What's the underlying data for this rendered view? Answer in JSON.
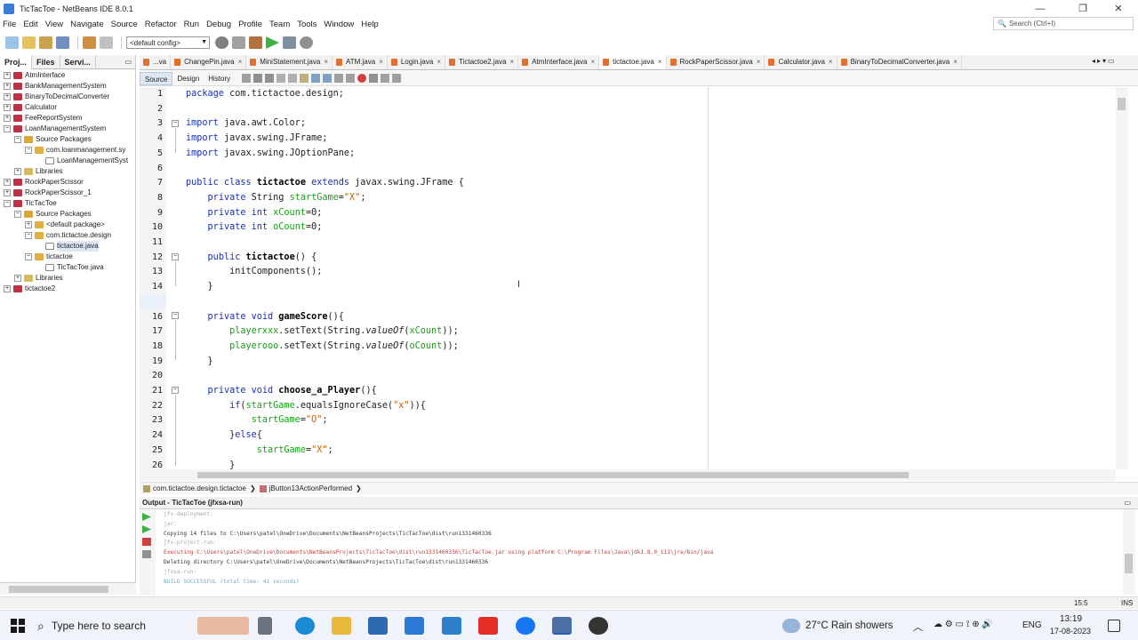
{
  "window": {
    "title": "TicTacToe - NetBeans IDE 8.0.1",
    "controls": [
      "—",
      "❐",
      "✕"
    ]
  },
  "menu": [
    "File",
    "Edit",
    "View",
    "Navigate",
    "Source",
    "Refactor",
    "Run",
    "Debug",
    "Profile",
    "Team",
    "Tools",
    "Window",
    "Help"
  ],
  "search": {
    "placeholder": "Search (Ctrl+I)"
  },
  "toolbar": {
    "config": "<default config>"
  },
  "left_panel": {
    "tabs": [
      "Proj...",
      "Files",
      "Servi..."
    ],
    "tree": [
      {
        "label": "AtmInterface",
        "type": "proj",
        "indent": 0,
        "exp": "+"
      },
      {
        "label": "BankManagementSystem",
        "type": "proj",
        "indent": 0,
        "exp": "+"
      },
      {
        "label": "BinaryToDecimalConverter",
        "type": "proj",
        "indent": 0,
        "exp": "+"
      },
      {
        "label": "Calculator",
        "type": "proj",
        "indent": 0,
        "exp": "+"
      },
      {
        "label": "FeeReportSystem",
        "type": "proj",
        "indent": 0,
        "exp": "+"
      },
      {
        "label": "LoanManagementSystem",
        "type": "proj",
        "indent": 0,
        "exp": "−"
      },
      {
        "label": "Source Packages",
        "type": "src",
        "indent": 1,
        "exp": "−"
      },
      {
        "label": "com.loanmanagement.sy",
        "type": "pkg",
        "indent": 2,
        "exp": "−"
      },
      {
        "label": "LoanManagementSyst",
        "type": "java",
        "indent": 3,
        "exp": ""
      },
      {
        "label": "Libraries",
        "type": "lib",
        "indent": 1,
        "exp": "+"
      },
      {
        "label": "RockPaperScissor",
        "type": "proj",
        "indent": 0,
        "exp": "+"
      },
      {
        "label": "RockPaperScissor_1",
        "type": "proj",
        "indent": 0,
        "exp": "+"
      },
      {
        "label": "TicTacToe",
        "type": "proj",
        "indent": 0,
        "exp": "−"
      },
      {
        "label": "Source Packages",
        "type": "src",
        "indent": 1,
        "exp": "−"
      },
      {
        "label": "<default package>",
        "type": "pkg",
        "indent": 2,
        "exp": "+"
      },
      {
        "label": "com.tictactoe.design",
        "type": "pkg",
        "indent": 2,
        "exp": "−"
      },
      {
        "label": "tictactoe.java",
        "type": "java",
        "indent": 3,
        "exp": "",
        "selected": true
      },
      {
        "label": "tictactoe",
        "type": "pkg",
        "indent": 2,
        "exp": "−"
      },
      {
        "label": "TicTacToe.java",
        "type": "java",
        "indent": 3,
        "exp": ""
      },
      {
        "label": "Libraries",
        "type": "lib",
        "indent": 1,
        "exp": "+"
      },
      {
        "label": "tictactoe2",
        "type": "proj",
        "indent": 0,
        "exp": "+"
      }
    ]
  },
  "editor_tabs": [
    {
      "label": "...va",
      "active": false,
      "close": false
    },
    {
      "label": "ChangePin.java",
      "active": false,
      "close": true
    },
    {
      "label": "MiniStatement.java",
      "active": false,
      "close": true
    },
    {
      "label": "ATM.java",
      "active": false,
      "close": true
    },
    {
      "label": "Login.java",
      "active": false,
      "close": true
    },
    {
      "label": "Tictactoe2.java",
      "active": false,
      "close": true
    },
    {
      "label": "AtmInterface.java",
      "active": false,
      "close": true
    },
    {
      "label": "tictactoe.java",
      "active": true,
      "close": true
    },
    {
      "label": "RockPaperScissor.java",
      "active": false,
      "close": true
    },
    {
      "label": "Calculator.java",
      "active": false,
      "close": true
    },
    {
      "label": "BinaryToDecimalConverter.java",
      "active": false,
      "close": true
    }
  ],
  "editor_views": [
    "Source",
    "Design",
    "History"
  ],
  "code_lines": [
    {
      "n": "1",
      "html": "<span class='kw'>package</span> com.tictactoe.design;"
    },
    {
      "n": "2",
      "html": ""
    },
    {
      "n": "3",
      "html": "<span class='kw'>import</span> java.awt.Color;"
    },
    {
      "n": "4",
      "html": "<span class='kw'>import</span> javax.swing.JFrame;"
    },
    {
      "n": "5",
      "html": "<span class='kw'>import</span> javax.swing.JOptionPane;"
    },
    {
      "n": "6",
      "html": ""
    },
    {
      "n": "7",
      "html": "<span class='kw'>public class</span> <span class='mth'>tictactoe</span> <span class='kw'>extends</span> javax.swing.JFrame {"
    },
    {
      "n": "8",
      "html": "    <span class='kw'>private</span> String <span class='fld'>startGame</span>=<span class='str'>\"X\"</span>;"
    },
    {
      "n": "9",
      "html": "    <span class='kw'>private int</span> <span class='fld'>xCount</span>=0;"
    },
    {
      "n": "10",
      "html": "    <span class='kw'>private int</span> <span class='fld'>oCount</span>=0;"
    },
    {
      "n": "11",
      "html": ""
    },
    {
      "n": "12",
      "html": "    <span class='kw'>public</span> <span class='mth'>tictactoe</span>() {"
    },
    {
      "n": "13",
      "html": "        initComponents();"
    },
    {
      "n": "14",
      "html": "    }"
    },
    {
      "n": "15",
      "html": ""
    },
    {
      "n": "16",
      "html": "    <span class='kw'>private void</span> <span class='mth'>gameScore</span>(){"
    },
    {
      "n": "17",
      "html": "        <span class='fld'>playerxxx</span>.setText(String.<span class='it'>valueOf</span>(<span class='fld'>xCount</span>));"
    },
    {
      "n": "18",
      "html": "        <span class='fld'>playerooo</span>.setText(String.<span class='it'>valueOf</span>(<span class='fld'>oCount</span>));"
    },
    {
      "n": "19",
      "html": "    }"
    },
    {
      "n": "20",
      "html": ""
    },
    {
      "n": "21",
      "html": "    <span class='kw'>private void</span> <span class='mth'>choose_a_Player</span>(){"
    },
    {
      "n": "22",
      "html": "        <span class='kw'>if</span>(<span class='fld'>startGame</span>.equalsIgnoreCase(<span class='str'>\"x\"</span>)){"
    },
    {
      "n": "23",
      "html": "            <span class='fld'>startGame</span>=<span class='str'>\"O\"</span>;"
    },
    {
      "n": "24",
      "html": "        }<span class='kw'>else</span>{"
    },
    {
      "n": "25",
      "html": "             <span class='fld'>startGame</span>=<span class='str'>\"X\"</span>;"
    },
    {
      "n": "26",
      "html": "        }"
    }
  ],
  "breadcrumb": [
    "com.tictactoe.design.tictactoe",
    "jButton13ActionPerformed"
  ],
  "output": {
    "title": "Output - TicTacToe (jfxsa-run)",
    "lines": [
      {
        "t": "jfx-deployment:",
        "c": "gray"
      },
      {
        "t": "jar:",
        "c": "gray"
      },
      {
        "t": "Copying 14 files to C:\\Users\\patel\\OneDrive\\Documents\\NetBeansProjects\\TicTacToe\\dist\\run1331460336",
        "c": ""
      },
      {
        "t": "jfx-project-run:",
        "c": "gray"
      },
      {
        "t": "Executing C:\\Users\\patel\\OneDrive\\Documents\\NetBeansProjects\\TicTacToe\\dist\\run1331460336\\TicTacToe.jar using platform C:\\Program Files\\Java\\jdk1.8.0_111\\jre/bin/java",
        "c": "red"
      },
      {
        "t": "Deleting directory C:\\Users\\patel\\OneDrive\\Documents\\NetBeansProjects\\TicTacToe\\dist\\run1331460336",
        "c": ""
      },
      {
        "t": "jfxsa-run:",
        "c": "gray"
      },
      {
        "t": "BUILD SUCCESSFUL (total time: 41 seconds)",
        "c": "green"
      }
    ]
  },
  "status": {
    "position": "15:5",
    "mode": "INS"
  },
  "taskbar": {
    "search_placeholder": "Type here to search",
    "weather": "27°C  Rain showers",
    "lang": "ENG",
    "time": "13:19",
    "date": "17-08-2023"
  }
}
